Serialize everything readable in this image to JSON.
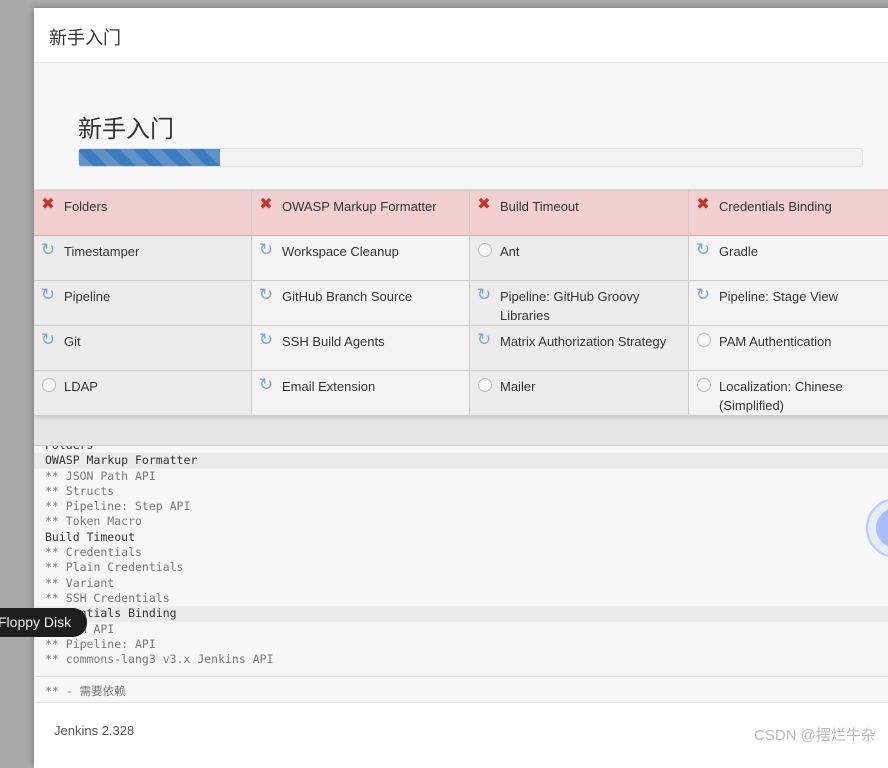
{
  "dialog": {
    "title": "新手入门"
  },
  "hero": {
    "title": "新手入门",
    "progress_percent": 18
  },
  "colors": {
    "accent": "#3b7bbf",
    "failed": "#c9302c",
    "spinner": "#7aa9c5"
  },
  "plugins": [
    {
      "name": "Folders",
      "status": "failed"
    },
    {
      "name": "OWASP Markup Formatter",
      "status": "failed"
    },
    {
      "name": "Build Timeout",
      "status": "failed"
    },
    {
      "name": "Credentials Binding",
      "status": "failed"
    },
    {
      "name": "Timestamper",
      "status": "installing"
    },
    {
      "name": "Workspace Cleanup",
      "status": "installing"
    },
    {
      "name": "Ant",
      "status": "pending"
    },
    {
      "name": "Gradle",
      "status": "installing"
    },
    {
      "name": "Pipeline",
      "status": "installing"
    },
    {
      "name": "GitHub Branch Source",
      "status": "installing"
    },
    {
      "name": "Pipeline: GitHub Groovy Libraries",
      "status": "installing"
    },
    {
      "name": "Pipeline: Stage View",
      "status": "installing"
    },
    {
      "name": "Git",
      "status": "installing"
    },
    {
      "name": "SSH Build Agents",
      "status": "installing"
    },
    {
      "name": "Matrix Authorization Strategy",
      "status": "installing"
    },
    {
      "name": "PAM Authentication",
      "status": "pending"
    },
    {
      "name": "LDAP",
      "status": "pending"
    },
    {
      "name": "Email Extension",
      "status": "installing"
    },
    {
      "name": "Mailer",
      "status": "pending"
    },
    {
      "name": "Localization: Chinese (Simplified)",
      "status": "pending"
    }
  ],
  "log": [
    {
      "text": "Folders",
      "dep": false,
      "hl": false
    },
    {
      "text": "OWASP Markup Formatter",
      "dep": false,
      "hl": true
    },
    {
      "text": "** JSON Path API",
      "dep": true,
      "hl": false
    },
    {
      "text": "** Structs",
      "dep": true,
      "hl": false
    },
    {
      "text": "** Pipeline: Step API",
      "dep": true,
      "hl": false
    },
    {
      "text": "** Token Macro",
      "dep": true,
      "hl": false
    },
    {
      "text": "Build Timeout",
      "dep": false,
      "hl": false
    },
    {
      "text": "** Credentials",
      "dep": true,
      "hl": false
    },
    {
      "text": "** Plain Credentials",
      "dep": true,
      "hl": false
    },
    {
      "text": "** Variant",
      "dep": true,
      "hl": false
    },
    {
      "text": "** SSH Credentials",
      "dep": true,
      "hl": false
    },
    {
      "text": "Credentials Binding",
      "dep": false,
      "hl": true
    },
    {
      "text": "** SCM API",
      "dep": true,
      "hl": false
    },
    {
      "text": "** Pipeline: API",
      "dep": true,
      "hl": false
    },
    {
      "text": "** commons-lang3 v3.x Jenkins API",
      "dep": true,
      "hl": false
    }
  ],
  "legend": "** - 需要依赖",
  "footer": {
    "version": "Jenkins 2.328"
  },
  "tooltip": "Floppy Disk",
  "watermark": "CSDN @摆烂牛杂"
}
